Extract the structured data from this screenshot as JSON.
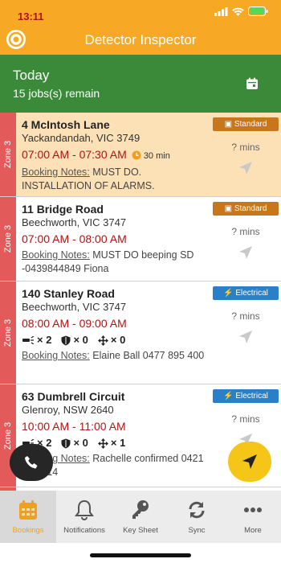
{
  "status": {
    "time": "13:11"
  },
  "app": {
    "title": "Detector Inspector"
  },
  "today": {
    "title": "Today",
    "subtitle": "15 jobs(s) remain"
  },
  "jobs": [
    {
      "zone": "Zone 3",
      "address": "4 McIntosh Lane",
      "suburb": "Yackandandah, VIC 3749",
      "time": "07:00 AM - 07:30 AM",
      "duration": "30 min",
      "notes_label": "Booking Notes:",
      "notes": " MUST DO. INSTALLATION OF ALARMS.",
      "badge": "Standard",
      "mins": "? mins",
      "highlight": "#fde1b6"
    },
    {
      "zone": "Zone 3",
      "address": "11 Bridge Road",
      "suburb": "Beechworth, VIC 3747",
      "time": "07:00 AM - 08:00 AM",
      "notes_label": "Booking Notes:",
      "notes": " MUST DO beeping SD -0439844849 Fiona",
      "badge": "Standard",
      "mins": "? mins"
    },
    {
      "zone": "Zone 3",
      "address": "140 Stanley Road",
      "suburb": "Beechworth, VIC 3747",
      "time": "08:00 AM - 09:00 AM",
      "counts": [
        "× 2",
        "× 0",
        "× 0"
      ],
      "notes_label": "Booking Notes:",
      "notes": " Elaine Ball      0477 895 400",
      "badge": "Electrical",
      "mins": "? mins"
    },
    {
      "zone": "Zone 3",
      "address": "63 Dumbrell Circuit",
      "suburb": "Glenroy, NSW 2640",
      "time": "10:00 AM - 11:00 AM",
      "counts": [
        "× 2",
        "× 0",
        "× 1"
      ],
      "notes_label": "Booking Notes:",
      "notes": " Rachelle confirmed 0421 415 814",
      "badge": "Electrical",
      "mins": "? mins"
    }
  ],
  "tabs": [
    {
      "label": "Bookings",
      "icon": "calendar-grid-icon",
      "active": true
    },
    {
      "label": "Notifications",
      "icon": "bell-icon"
    },
    {
      "label": "Key Sheet",
      "icon": "key-icon"
    },
    {
      "label": "Sync",
      "icon": "sync-icon"
    },
    {
      "label": "More",
      "icon": "more-dots-icon"
    }
  ],
  "colors": {
    "brand": "#f7a825",
    "today": "#3a8a3a",
    "zone": "#e25a5a",
    "time": "#b01414",
    "standard": "#c8761a",
    "electrical": "#2a7fc9",
    "active_tab": "#f0a020"
  }
}
